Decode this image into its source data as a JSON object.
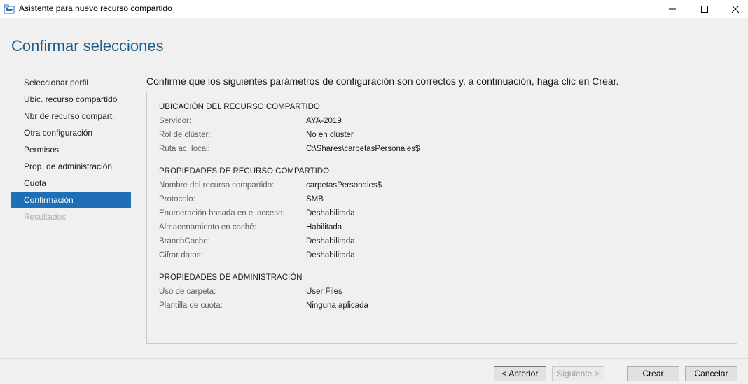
{
  "window": {
    "title": "Asistente para nuevo recurso compartido",
    "controls": {
      "minimize_icon": "minimize-icon",
      "maximize_icon": "maximize-icon",
      "close_icon": "close-icon"
    }
  },
  "page": {
    "title": "Confirmar selecciones",
    "instruction": "Confirme que los siguientes parámetros de configuración son correctos y, a continuación, haga clic en Crear."
  },
  "nav": {
    "items": [
      {
        "label": "Seleccionar perfil",
        "state": "normal"
      },
      {
        "label": "Ubic. recurso compartido",
        "state": "normal"
      },
      {
        "label": "Nbr de recurso compart.",
        "state": "normal"
      },
      {
        "label": "Otra configuración",
        "state": "normal"
      },
      {
        "label": "Permisos",
        "state": "normal"
      },
      {
        "label": "Prop. de administración",
        "state": "normal"
      },
      {
        "label": "Cuota",
        "state": "normal"
      },
      {
        "label": "Confirmación",
        "state": "active"
      },
      {
        "label": "Resultados",
        "state": "disabled"
      }
    ]
  },
  "sections": [
    {
      "title": "UBICACIÓN DEL RECURSO COMPARTIDO",
      "rows": [
        {
          "label": "Servidor:",
          "value": "AYA-2019"
        },
        {
          "label": "Rol de clúster:",
          "value": "No en clúster"
        },
        {
          "label": "Ruta ac. local:",
          "value": "C:\\Shares\\carpetasPersonales$"
        }
      ]
    },
    {
      "title": "PROPIEDADES DE RECURSO COMPARTIDO",
      "rows": [
        {
          "label": "Nombre del recurso compartido:",
          "value": "carpetasPersonales$"
        },
        {
          "label": "Protocolo:",
          "value": "SMB"
        },
        {
          "label": "Enumeración basada en el acceso:",
          "value": "Deshabilitada"
        },
        {
          "label": "Almacenamiento en caché:",
          "value": "Habilitada"
        },
        {
          "label": "BranchCache:",
          "value": "Deshabilitada"
        },
        {
          "label": "Cifrar datos:",
          "value": "Deshabilitada"
        }
      ]
    },
    {
      "title": "PROPIEDADES DE ADMINISTRACIÓN",
      "rows": [
        {
          "label": "Uso de carpeta:",
          "value": "User Files"
        },
        {
          "label": "Plantilla de cuota:",
          "value": "Ninguna aplicada"
        }
      ]
    }
  ],
  "footer": {
    "prev_label": "< Anterior",
    "next_label": "Siguiente >",
    "create_label": "Crear",
    "cancel_label": "Cancelar"
  },
  "colors": {
    "accent": "#1e6fb8",
    "title": "#1e5f8e",
    "background": "#f0f0f0"
  }
}
